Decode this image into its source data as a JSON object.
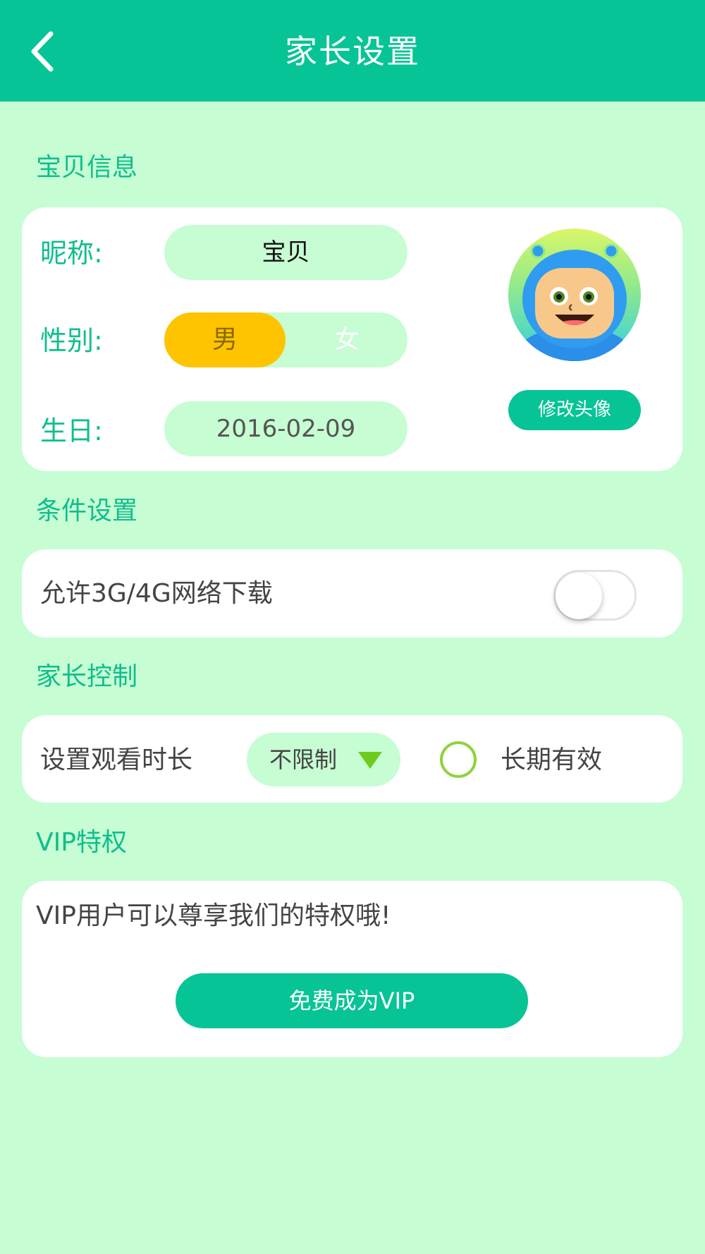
{
  "header": {
    "title": "家长设置",
    "back_icon": "chevron-left-icon"
  },
  "baby_info": {
    "section_title": "宝贝信息",
    "nickname_label": "昵称:",
    "nickname_value": "宝贝",
    "gender_label": "性别:",
    "gender_options": [
      "男",
      "女"
    ],
    "gender_selected": "男",
    "birthday_label": "生日:",
    "birthday_value": "2016-02-09",
    "change_avatar_label": "修改头像"
  },
  "conditions": {
    "section_title": "条件设置",
    "network_download_label": "允许3G/4G网络下载",
    "network_download_enabled": false
  },
  "parental_control": {
    "section_title": "家长控制",
    "watch_time_label": "设置观看时长",
    "watch_time_value": "不限制",
    "long_term_label": "长期有效",
    "long_term_checked": false
  },
  "vip": {
    "section_title": "VIP特权",
    "description": "VIP用户可以尊享我们的特权哦!",
    "button_label": "免费成为VIP"
  },
  "colors": {
    "primary": "#06c495",
    "background": "#c6fdd3",
    "accent_yellow": "#ffc400",
    "radio_green": "#8fd23f"
  }
}
